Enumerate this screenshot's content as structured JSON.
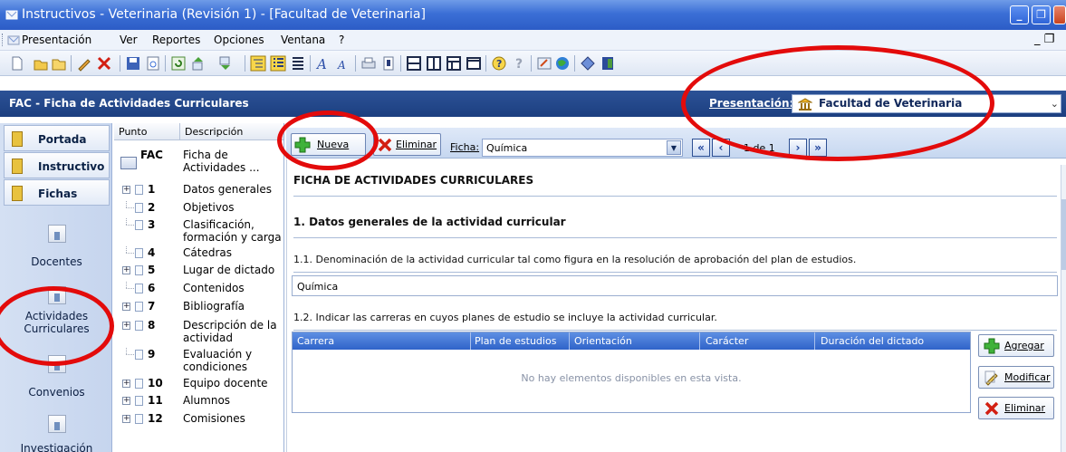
{
  "window": {
    "title": "Instructivos - Veterinaria (Revisión 1) - [Facultad de Veterinaria]",
    "controls": [
      "_",
      "❐",
      "✕"
    ]
  },
  "menu": {
    "items": [
      {
        "label": "Presentación"
      },
      {
        "label": "Ver"
      },
      {
        "label": "Reportes"
      },
      {
        "label": "Opciones"
      },
      {
        "label": "Ventana"
      },
      {
        "label": "?"
      }
    ],
    "mdi_controls": "_ ❐"
  },
  "form": {
    "title": "FAC - Ficha de Actividades Curriculares",
    "presentacion_label": "Presentación:",
    "presentacion_value": "Facultad de Veterinaria"
  },
  "nav": {
    "tabs": [
      {
        "label": "Portada"
      },
      {
        "label": "Instructivo"
      },
      {
        "label": "Fichas"
      }
    ],
    "items": [
      {
        "label": "Docentes"
      },
      {
        "label": "Actividades Curriculares"
      },
      {
        "label": "Convenios"
      },
      {
        "label": "Investigación"
      }
    ]
  },
  "tree": {
    "col_punto": "Punto",
    "col_descripcion": "Descripción",
    "root": {
      "code": "FAC",
      "desc": "Ficha de Actividades ..."
    },
    "rows": [
      {
        "num": "1",
        "desc": "Datos generales",
        "expandable": true
      },
      {
        "num": "2",
        "desc": "Objetivos",
        "expandable": false
      },
      {
        "num": "3",
        "desc": "Clasificación, formación y carga",
        "expandable": false
      },
      {
        "num": "4",
        "desc": "Cátedras",
        "expandable": false
      },
      {
        "num": "5",
        "desc": "Lugar de dictado",
        "expandable": true
      },
      {
        "num": "6",
        "desc": "Contenidos",
        "expandable": false
      },
      {
        "num": "7",
        "desc": "Bibliografía",
        "expandable": true
      },
      {
        "num": "8",
        "desc": "Descripción de la actividad",
        "expandable": true
      },
      {
        "num": "9",
        "desc": "Evaluación y condiciones",
        "expandable": false
      },
      {
        "num": "10",
        "desc": "Equipo docente",
        "expandable": true
      },
      {
        "num": "11",
        "desc": "Alumnos",
        "expandable": true
      },
      {
        "num": "12",
        "desc": "Comisiones",
        "expandable": true
      }
    ]
  },
  "record_bar": {
    "nueva": "Nueva",
    "eliminar": "Eliminar",
    "ficha_label": "Ficha:",
    "ficha_value": "Química",
    "pager": "1 de 1"
  },
  "form_body": {
    "main_title": "FICHA DE ACTIVIDADES CURRICULARES",
    "section1": "1. Datos generales de la actividad curricular",
    "q11": "1.1. Denominación de la actividad curricular tal como figura en la resolución de aprobación del plan de estudios.",
    "q11_value": "Química",
    "q12": "1.2. Indicar las carreras en cuyos planes de estudio se incluye la actividad curricular.",
    "grid_columns": [
      "Carrera",
      "Plan de estudios",
      "Orientación",
      "Carácter",
      "Duración del dictado"
    ],
    "grid_empty": "No hay elementos disponibles en esta vista.",
    "agregar": "Agregar",
    "modificar": "Modificar",
    "eliminar": "Eliminar"
  },
  "colors": {
    "titlebar": "#3b6fd6",
    "header_strip": "#1c3f80",
    "annotation": "#e30b0b",
    "grid_header": "#2f63c9"
  }
}
